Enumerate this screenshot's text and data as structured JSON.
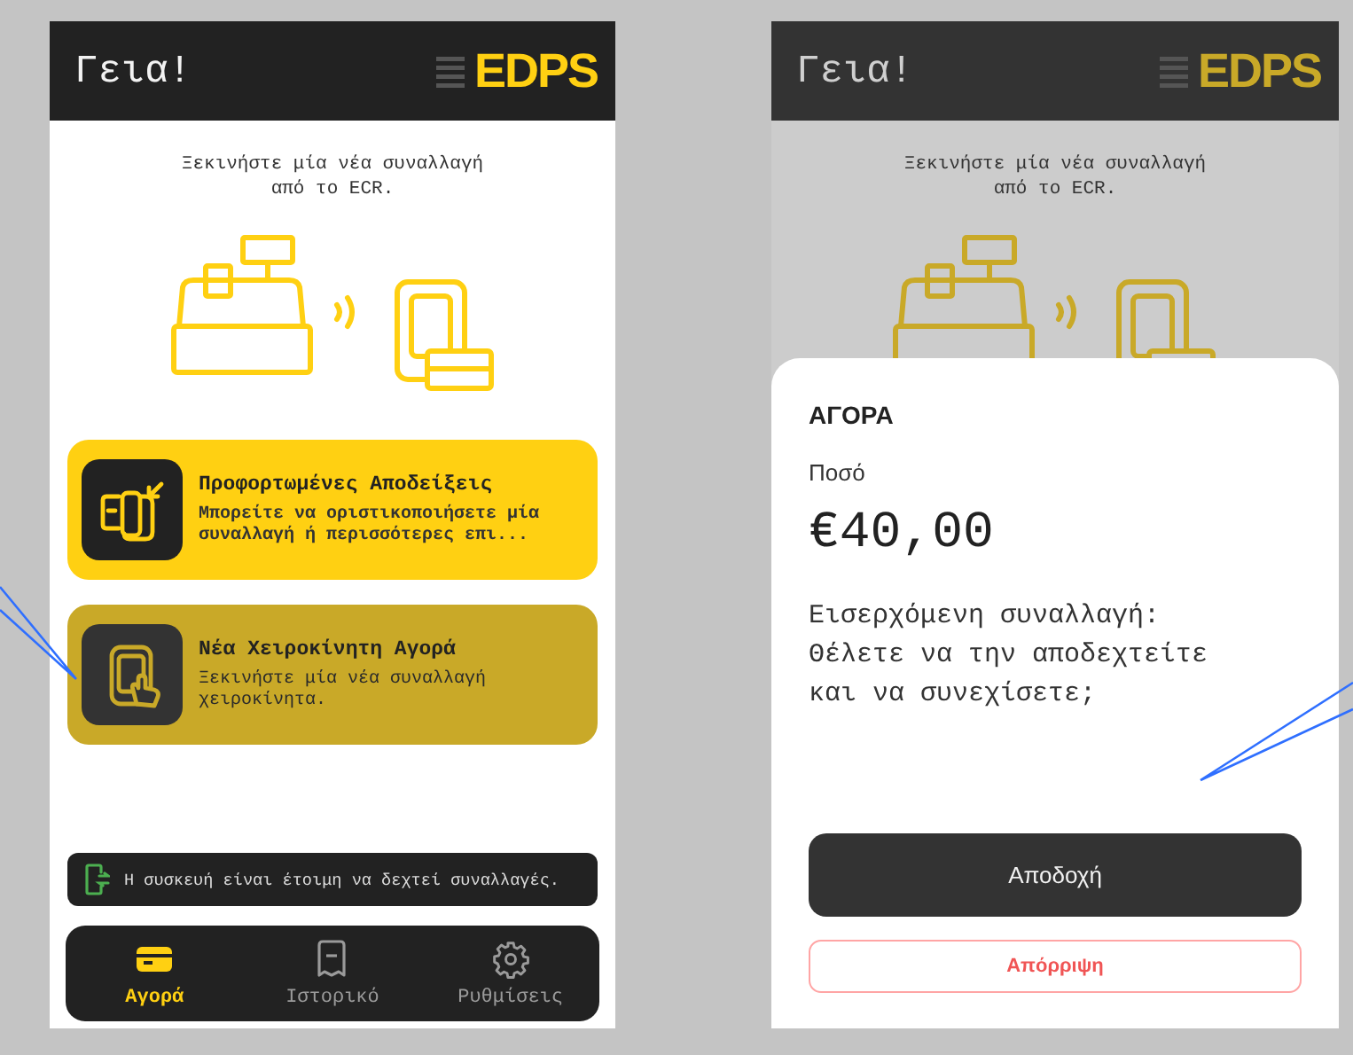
{
  "screens": [
    {
      "kind": "home",
      "dimmed": false,
      "header": {
        "greeting": "Γεια!",
        "logo": "EDPS"
      },
      "prompt": "Ξεκινήστε μία νέα συναλλαγή\nαπό το ECR.",
      "cards": [
        {
          "kind": "receipts",
          "title": "Προφορτωμένες Αποδείξεις",
          "description": "Μπορείτε να οριστικοποιήσετε μία\nσυναλλαγή ή περισσότερες επι...",
          "selected": false
        },
        {
          "kind": "manual",
          "title": "Νέα Χειροκίνητη Αγορά",
          "description": "Ξεκινήστε μία νέα συναλλαγή\nχειροκίνητα.",
          "selected": true
        }
      ],
      "status": "Η συσκευή είναι έτοιμη να δεχτεί συναλλαγές.",
      "nav": [
        {
          "kind": "card",
          "label": "Αγορά",
          "selected": true
        },
        {
          "kind": "receipt",
          "label": "Ιστορικό",
          "selected": false
        },
        {
          "kind": "gear",
          "label": "Ρυθμίσεις",
          "selected": false
        }
      ]
    },
    {
      "kind": "dialog",
      "dimmed": true,
      "header": {
        "greeting": "Γεια!",
        "logo": "EDPS"
      },
      "prompt": "Ξεκινήστε μία νέα συναλλαγή\nαπό το ECR.",
      "dialog": {
        "title": "ΑΓΟΡΑ",
        "amount_label": "Ποσό",
        "amount": "€40,00",
        "message": "Εισερχόμενη συναλλαγή:\nΘέλετε να την αποδεχτείτε\nκαι να συνεχίσετε;",
        "buttons": [
          {
            "kind": "primary",
            "label": "Αποδοχή"
          },
          {
            "kind": "danger",
            "label": "Απόρριψη"
          }
        ]
      }
    }
  ]
}
